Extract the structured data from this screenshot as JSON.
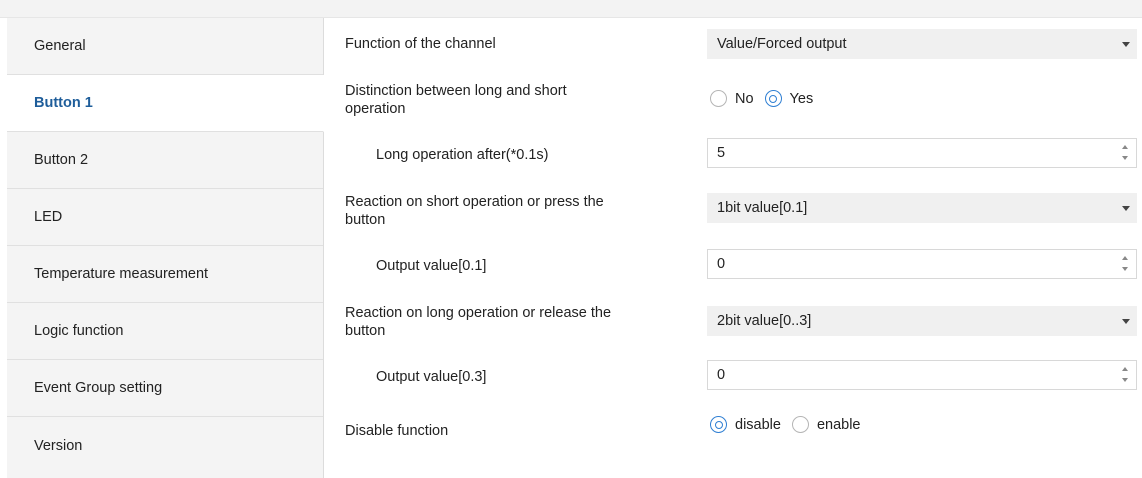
{
  "sidebar": {
    "items": [
      {
        "label": "General"
      },
      {
        "label": "Button 1"
      },
      {
        "label": "Button 2"
      },
      {
        "label": "LED"
      },
      {
        "label": "Temperature measurement"
      },
      {
        "label": "Logic function"
      },
      {
        "label": "Event Group setting"
      },
      {
        "label": "Version"
      }
    ],
    "active": "Button 1"
  },
  "params": {
    "function_channel": {
      "label": "Function of the channel",
      "value": "Value/Forced output"
    },
    "distinction": {
      "label_line1": "Distinction between long and short",
      "label_line2": "operation",
      "option_no": "No",
      "option_yes": "Yes",
      "selected": "Yes"
    },
    "long_operation": {
      "label": "Long operation after(*0.1s)",
      "value": "5"
    },
    "reaction_short": {
      "label_line1": "Reaction on short operation or press the",
      "label_line2": "button",
      "value": "1bit value[0.1]"
    },
    "output_value_1": {
      "label": "Output value[0.1]",
      "value": "0"
    },
    "reaction_long": {
      "label_line1": "Reaction on long operation or release the",
      "label_line2": "button",
      "value": "2bit value[0..3]"
    },
    "output_value_2": {
      "label": "Output value[0.3]",
      "value": "0"
    },
    "disable_function": {
      "label": "Disable function",
      "option_disable": "disable",
      "option_enable": "enable",
      "selected": "disable"
    }
  }
}
